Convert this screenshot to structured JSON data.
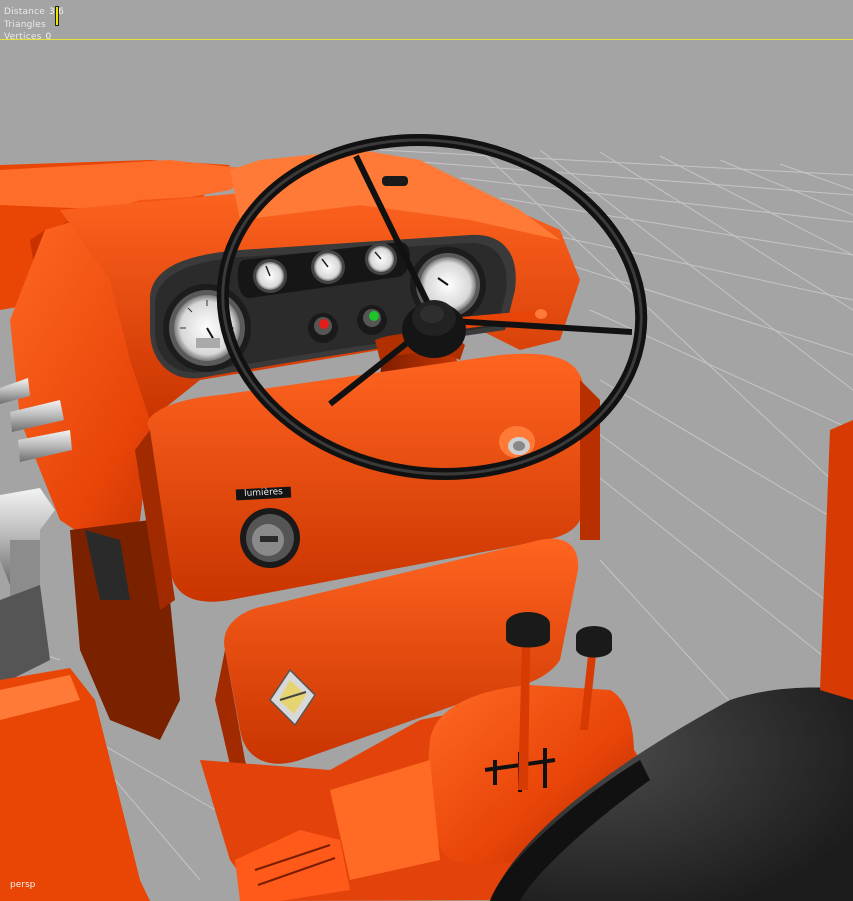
{
  "hud": {
    "distance_label": "Distance",
    "distance_value": "3.6",
    "triangles_label": "Triangles",
    "vertices_label": "Vertices",
    "vertices_value": "0"
  },
  "camera": {
    "name": "persp"
  },
  "scene": {
    "switch_label": "lumières"
  },
  "colors": {
    "viewport_bg": "#a4a4a4",
    "body_orange": "#ee4a0c",
    "horizon": "#e4e23a"
  }
}
